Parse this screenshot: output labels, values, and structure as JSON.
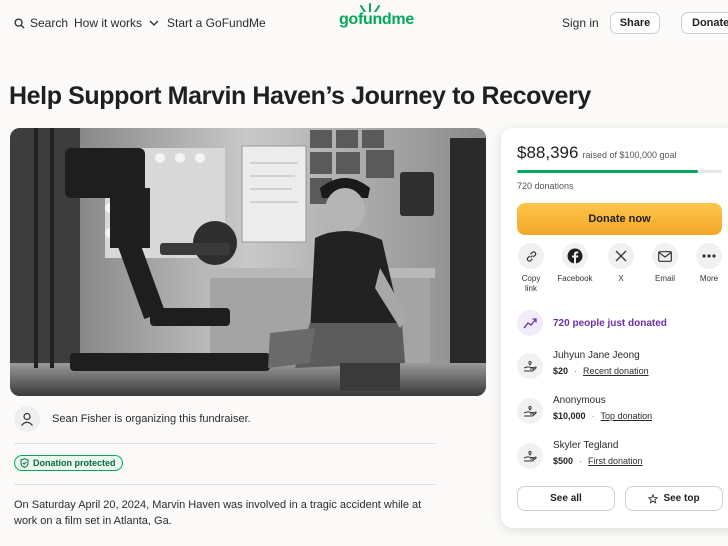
{
  "header": {
    "search_label": "Search",
    "how_it_works_label": "How it works",
    "start_label": "Start a GoFundMe",
    "logo_text": "gofundme",
    "sign_in_label": "Sign in",
    "share_label": "Share",
    "donate_label": "Donate"
  },
  "campaign": {
    "title": "Help Support Marvin Haven’s Journey to Recovery",
    "organizer_text": "Sean Fisher is organizing this fundraiser.",
    "protected_badge": "Donation protected",
    "story": "On Saturday April 20, 2024, Marvin Haven was involved in a tragic accident while at work on a film set in Atlanta, Ga."
  },
  "donation": {
    "raised": "$88,396",
    "goal_text": "raised of $100,000 goal",
    "progress_fraction": 0.884,
    "donation_count": "720 donations",
    "donate_now_label": "Donate now",
    "share_options": [
      {
        "label": "Copy link",
        "icon": "link-icon"
      },
      {
        "label": "Facebook",
        "icon": "facebook-icon"
      },
      {
        "label": "X",
        "icon": "x-icon"
      },
      {
        "label": "Email",
        "icon": "email-icon"
      },
      {
        "label": "More",
        "icon": "more-icon"
      }
    ],
    "just_donated": "720 people just donated",
    "donors": [
      {
        "name": "Juhyun Jane Jeong",
        "amount": "$20",
        "tag": "Recent donation"
      },
      {
        "name": "Anonymous",
        "amount": "$10,000",
        "tag": "Top donation"
      },
      {
        "name": "Skyler Tegland",
        "amount": "$500",
        "tag": "First donation"
      }
    ],
    "see_all_label": "See all",
    "see_top_label": "See top"
  },
  "colors": {
    "brand_green": "#02a95c",
    "donate_orange": "#f4a82a",
    "purple": "#6b2fa8"
  }
}
